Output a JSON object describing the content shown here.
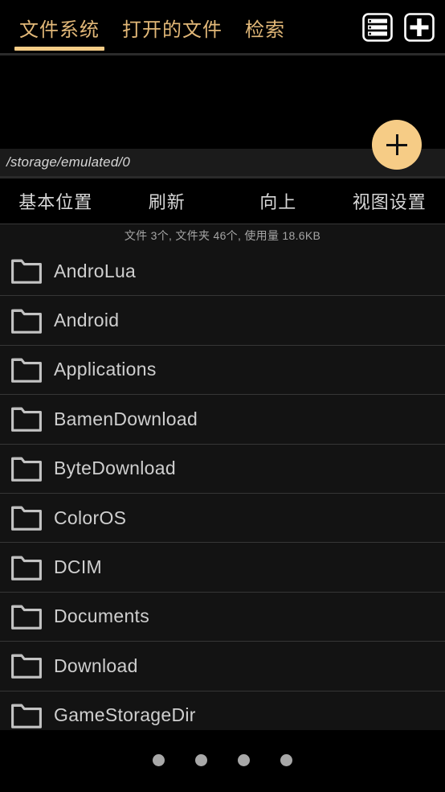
{
  "app": {
    "accent_color": "#f6cc86",
    "tab_text_color": "#e2b878",
    "background_color": "#000000",
    "list_background_color": "#131313",
    "text_color": "#cfcfcf"
  },
  "tabbar": {
    "tabs": [
      {
        "label": "文件系统",
        "active": true
      },
      {
        "label": "打开的文件",
        "active": false
      },
      {
        "label": "检索",
        "active": false
      }
    ],
    "actions": [
      {
        "name": "list-view-icon",
        "label": "列表"
      },
      {
        "name": "add-icon",
        "label": "新建"
      }
    ]
  },
  "fab": {
    "name": "add-fab",
    "label": "+"
  },
  "pathbar": {
    "path": "/storage/emulated/0"
  },
  "toolbar": {
    "items": [
      {
        "label": "基本位置"
      },
      {
        "label": "刷新"
      },
      {
        "label": "向上"
      },
      {
        "label": "视图设置"
      }
    ]
  },
  "status": {
    "text": "文件 3个, 文件夹 46个, 使用量 18.6KB"
  },
  "filelist": {
    "items": [
      {
        "name": "AndroLua",
        "type": "folder"
      },
      {
        "name": "Android",
        "type": "folder"
      },
      {
        "name": "Applications",
        "type": "folder"
      },
      {
        "name": "BamenDownload",
        "type": "folder"
      },
      {
        "name": "ByteDownload",
        "type": "folder"
      },
      {
        "name": "ColorOS",
        "type": "folder"
      },
      {
        "name": "DCIM",
        "type": "folder"
      },
      {
        "name": "Documents",
        "type": "folder"
      },
      {
        "name": "Download",
        "type": "folder"
      },
      {
        "name": "GameStorageDir",
        "type": "folder"
      }
    ]
  },
  "bottombar": {
    "dots": [
      {
        "active": false
      },
      {
        "active": false
      },
      {
        "active": false
      },
      {
        "active": false
      }
    ]
  }
}
